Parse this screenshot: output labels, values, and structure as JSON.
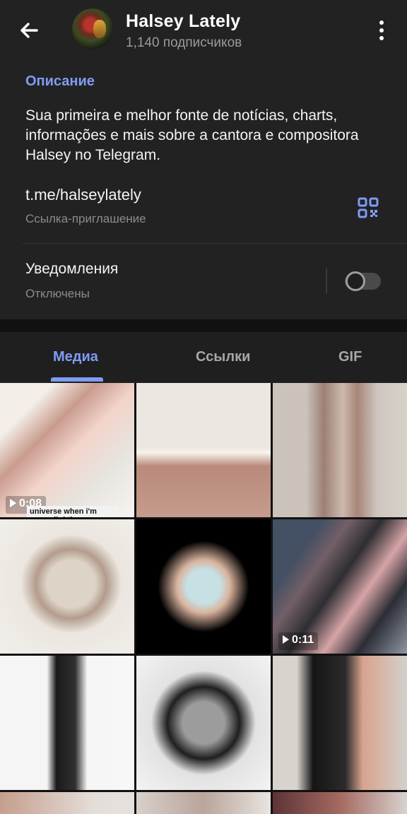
{
  "header": {
    "title": "Halsey Lately",
    "subtitle": "1,140 подписчиков",
    "back_icon": "arrow-left-icon",
    "menu_icon": "more-vertical-icon"
  },
  "info": {
    "section_title": "Описание",
    "description": "Sua primeira e melhor fonte de notícias, charts, informações e mais sobre a cantora e compositora Halsey no Telegram.",
    "link": "t.me/halseylately",
    "link_label": "Ссылка-приглашение",
    "qr_icon": "qr-code-icon",
    "notifications_label": "Уведомления",
    "notifications_status": "Отключены",
    "notifications_enabled": false
  },
  "tabs": [
    {
      "label": "Медиа",
      "active": true
    },
    {
      "label": "Ссылки",
      "active": false
    },
    {
      "label": "GIF",
      "active": false
    }
  ],
  "media": [
    {
      "duration": "0:08",
      "caption": "universe when i'm even slightly overwhelmed"
    },
    {
      "duration": ""
    },
    {
      "duration": ""
    },
    {
      "duration": ""
    },
    {
      "duration": ""
    },
    {
      "duration": "0:11"
    },
    {
      "duration": ""
    },
    {
      "duration": ""
    },
    {
      "duration": ""
    }
  ],
  "colors": {
    "accent": "#7f9cf5",
    "panel": "#222222",
    "background": "#111111"
  }
}
